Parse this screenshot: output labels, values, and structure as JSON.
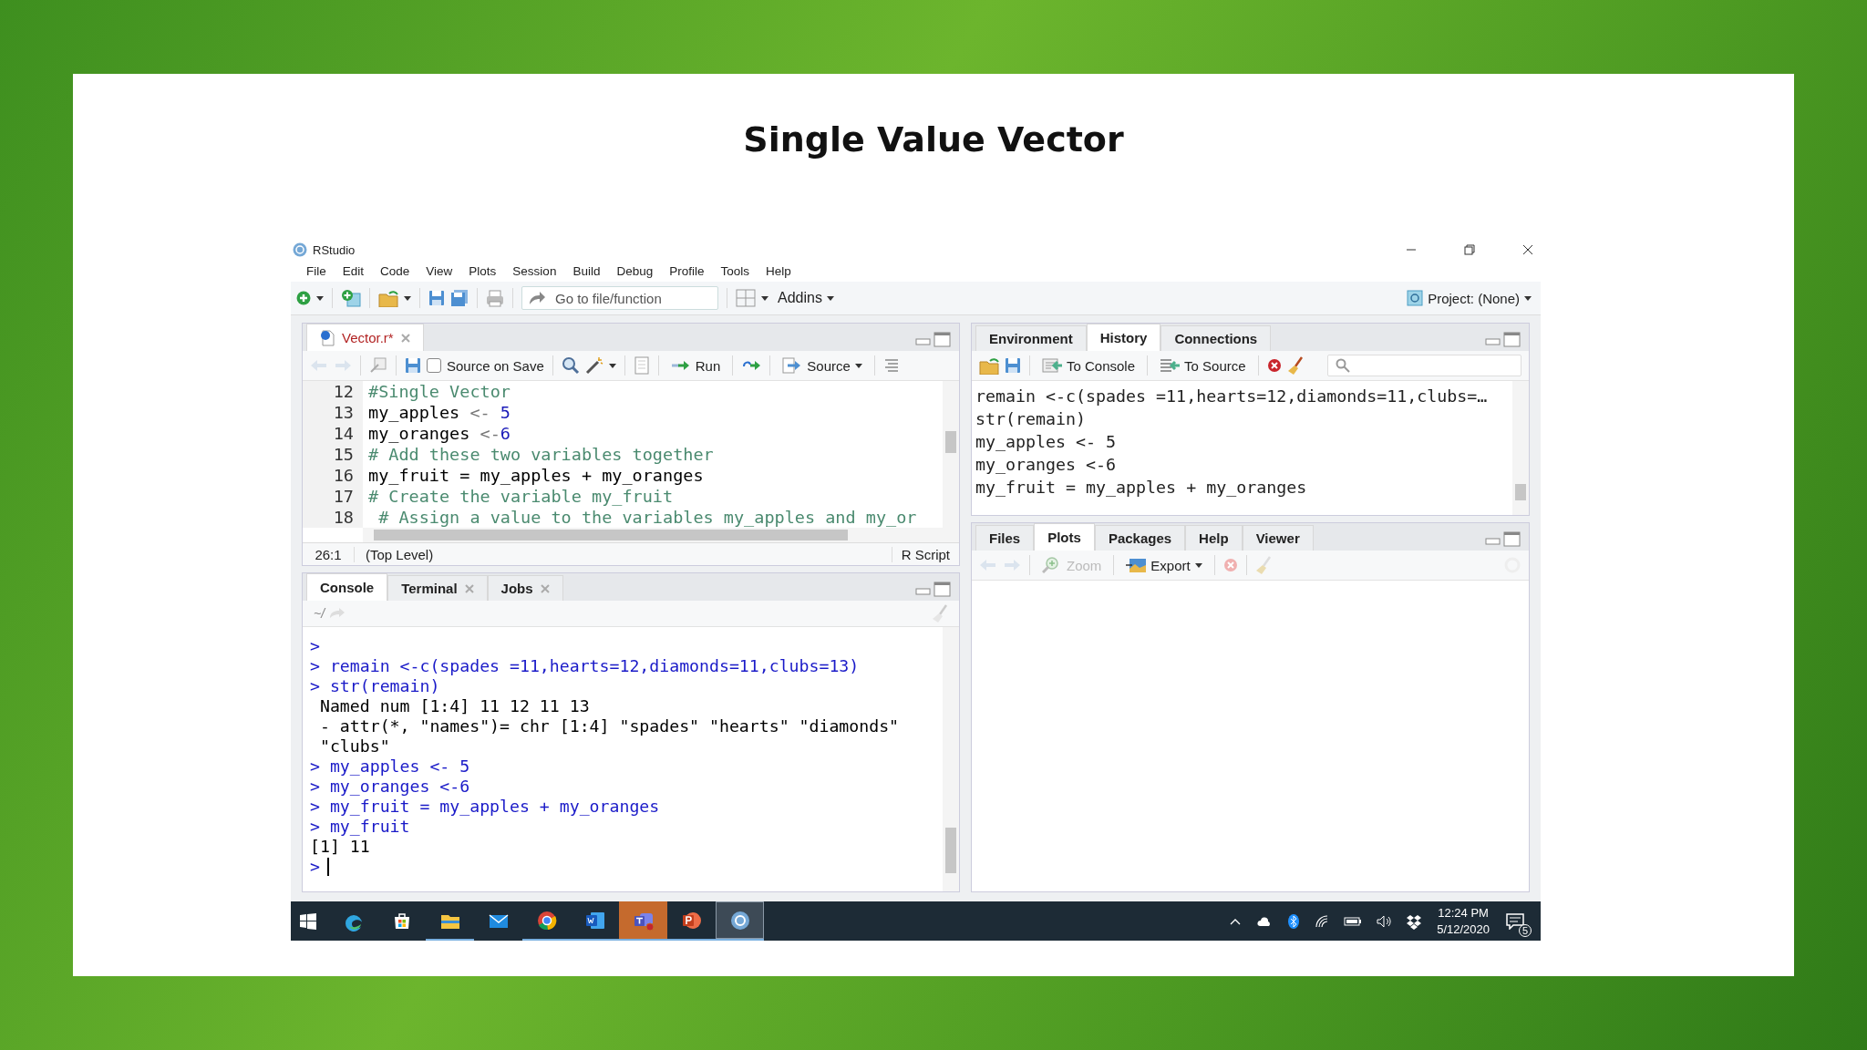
{
  "slide": {
    "title": "Single Value Vector"
  },
  "window": {
    "title": "RStudio",
    "menu": [
      "File",
      "Edit",
      "Code",
      "View",
      "Plots",
      "Session",
      "Build",
      "Debug",
      "Profile",
      "Tools",
      "Help"
    ]
  },
  "toolbar": {
    "goto_placeholder": "Go to file/function",
    "addins": "Addins",
    "project": "Project: (None)"
  },
  "editor": {
    "tabs": [
      {
        "label": "Vector.r*",
        "selected": true,
        "modified": true
      }
    ],
    "source_on_save": {
      "label": "Source on Save",
      "checked": false
    },
    "run": "Run",
    "source": "Source",
    "lines": [
      {
        "number": "12",
        "parts": [
          {
            "kind": "comment",
            "text": "#Single Vector"
          }
        ]
      },
      {
        "number": "13",
        "parts": [
          {
            "kind": "plain",
            "text": "my_apples "
          },
          {
            "kind": "operator",
            "text": "<- "
          },
          {
            "kind": "number",
            "text": "5"
          }
        ]
      },
      {
        "number": "14",
        "parts": [
          {
            "kind": "plain",
            "text": "my_oranges "
          },
          {
            "kind": "operator",
            "text": "<-"
          },
          {
            "kind": "number",
            "text": "6"
          }
        ]
      },
      {
        "number": "15",
        "parts": [
          {
            "kind": "comment",
            "text": "# Add these two variables together"
          }
        ]
      },
      {
        "number": "16",
        "parts": [
          {
            "kind": "plain",
            "text": "my_fruit = my_apples + my_oranges"
          }
        ]
      },
      {
        "number": "17",
        "parts": [
          {
            "kind": "comment",
            "text": "# Create the variable my_fruit"
          }
        ]
      },
      {
        "number": "18",
        "parts": [
          {
            "kind": "comment",
            "text": " # Assign a value to the variables my_apples and my_or"
          }
        ]
      }
    ],
    "status": {
      "position": "26:1",
      "scope": "(Top Level)",
      "filetype": "R Script"
    }
  },
  "console": {
    "tabs": [
      {
        "label": "Console",
        "selected": true,
        "closable": false
      },
      {
        "label": "Terminal",
        "selected": false,
        "closable": true
      },
      {
        "label": "Jobs",
        "selected": false,
        "closable": true
      }
    ],
    "path": "~/",
    "lines": [
      {
        "kind": "input",
        "text": ">"
      },
      {
        "kind": "input",
        "text": "> remain <-c(spades =11,hearts=12,diamonds=11,clubs=13)"
      },
      {
        "kind": "input",
        "text": "> str(remain)"
      },
      {
        "kind": "output",
        "text": " Named num [1:4] 11 12 11 13"
      },
      {
        "kind": "output",
        "text": " - attr(*, \"names\")= chr [1:4] \"spades\" \"hearts\" \"diamonds\""
      },
      {
        "kind": "output",
        "text": " \"clubs\""
      },
      {
        "kind": "input",
        "text": "> my_apples <- 5"
      },
      {
        "kind": "input",
        "text": "> my_oranges <-6"
      },
      {
        "kind": "input",
        "text": "> my_fruit = my_apples + my_oranges"
      },
      {
        "kind": "input",
        "text": "> my_fruit"
      },
      {
        "kind": "output",
        "text": "[1] 11"
      },
      {
        "kind": "prompt",
        "text": ">"
      }
    ]
  },
  "history": {
    "tabs": [
      {
        "label": "Environment",
        "selected": false
      },
      {
        "label": "History",
        "selected": true
      },
      {
        "label": "Connections",
        "selected": false
      }
    ],
    "to_console": "To Console",
    "to_source": "To Source",
    "lines": [
      "remain <-c(spades =11,hearts=12,diamonds=11,clubs=…",
      "str(remain)",
      "my_apples <- 5",
      "my_oranges <-6",
      "my_fruit = my_apples + my_oranges"
    ]
  },
  "files": {
    "tabs": [
      {
        "label": "Files",
        "selected": false
      },
      {
        "label": "Plots",
        "selected": true
      },
      {
        "label": "Packages",
        "selected": false
      },
      {
        "label": "Help",
        "selected": false
      },
      {
        "label": "Viewer",
        "selected": false
      }
    ],
    "tools": [
      {
        "kind": "zoom",
        "label": "Zoom",
        "disabled": true
      },
      {
        "kind": "export",
        "label": "Export",
        "disabled": false
      }
    ]
  },
  "taskbar": {
    "apps": [
      {
        "kind": "edge",
        "running": false,
        "selected": false,
        "flashing": false
      },
      {
        "kind": "store",
        "running": false,
        "selected": false,
        "flashing": false
      },
      {
        "kind": "explorer",
        "running": true,
        "selected": false,
        "flashing": false
      },
      {
        "kind": "mail",
        "running": false,
        "selected": false,
        "flashing": false
      },
      {
        "kind": "chrome",
        "running": true,
        "selected": false,
        "flashing": false
      },
      {
        "kind": "word",
        "running": true,
        "selected": false,
        "flashing": false
      },
      {
        "kind": "teams",
        "running": true,
        "selected": false,
        "flashing": true
      },
      {
        "kind": "powerpoint",
        "running": true,
        "selected": false,
        "flashing": false
      },
      {
        "kind": "rstudio",
        "running": true,
        "selected": true,
        "flashing": false
      }
    ],
    "time": "12:24 PM",
    "date": "5/12/2020",
    "notifications": "5"
  }
}
